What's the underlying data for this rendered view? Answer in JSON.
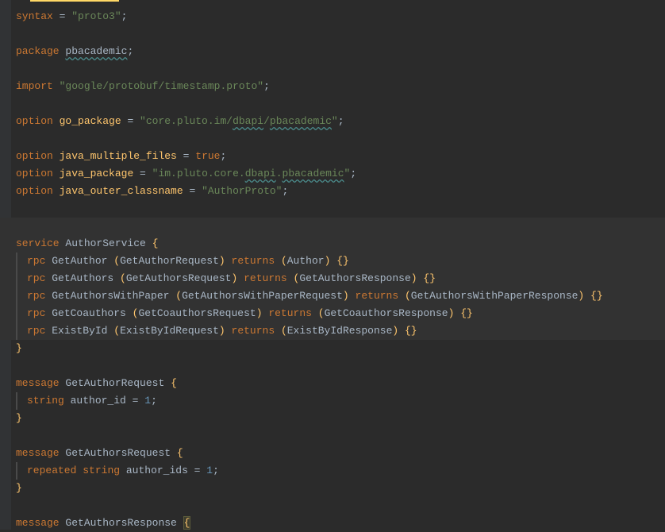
{
  "colors": {
    "bg": "#2b2b2b",
    "keyword": "#cc7832",
    "string": "#6a8759",
    "ident": "#ffc66d",
    "number": "#6897bb"
  },
  "code": {
    "syntax_kw": "syntax",
    "syntax_val": "\"proto3\"",
    "package_kw": "package",
    "package_name": "pbacademic",
    "import_kw": "import",
    "import_path": "\"google/protobuf/timestamp.proto\"",
    "option_kw": "option",
    "go_package_key": "go_package",
    "go_package_prefix": "\"core.pluto.im/",
    "go_package_p1": "dbapi",
    "go_package_p2": "pbacademic",
    "java_multi_key": "java_multiple_files",
    "java_multi_val": "true",
    "java_package_key": "java_package",
    "java_package_prefix": "\"im.pluto.core.",
    "java_package_p1": "dbapi",
    "java_package_p2": "pbacademic",
    "java_outer_key": "java_outer_classname",
    "java_outer_val": "\"AuthorProto\"",
    "service_kw": "service",
    "service_name": "AuthorService",
    "rpc_kw": "rpc",
    "returns_kw": "returns",
    "rpc1_name": "GetAuthor",
    "rpc1_req": "GetAuthorRequest",
    "rpc1_res": "Author",
    "rpc2_name": "GetAuthors",
    "rpc2_req": "GetAuthorsRequest",
    "rpc2_res": "GetAuthorsResponse",
    "rpc3_name": "GetAuthorsWithPaper",
    "rpc3_req": "GetAuthorsWithPaperRequest",
    "rpc3_res": "GetAuthorsWithPaperResponse",
    "rpc4_name": "GetCoauthors",
    "rpc4_req": "GetCoauthorsRequest",
    "rpc4_res": "GetCoauthorsResponse",
    "rpc5_name": "ExistById",
    "rpc5_req": "ExistByIdRequest",
    "rpc5_res": "ExistByIdResponse",
    "message_kw": "message",
    "msg1_name": "GetAuthorRequest",
    "msg1_type": "string",
    "msg1_field": "author_id",
    "msg1_num": "1",
    "msg2_name": "GetAuthorsRequest",
    "msg2_repeated": "repeated",
    "msg2_type": "string",
    "msg2_field": "author_ids",
    "msg2_num": "1",
    "msg3_name": "GetAuthorsResponse",
    "semi": ";",
    "eq": " = ",
    "lbrace": "{",
    "rbrace": "}",
    "lparen": "(",
    "rparen": ")",
    "ebraces": "{}",
    "slash": "/",
    "dot": ".",
    "quote": "\""
  }
}
